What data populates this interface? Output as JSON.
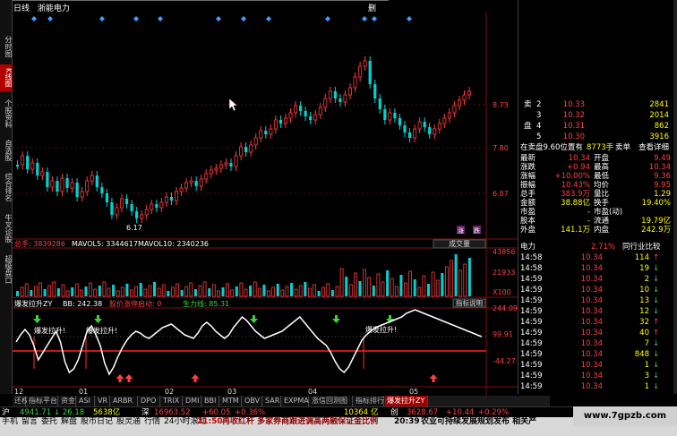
{
  "app": {
    "chart_mode": "日线",
    "stock_name": "浙能电力",
    "corner_label": "删"
  },
  "left_tabs": [
    "分时图",
    "K线图",
    "个股资料",
    "自选股",
    "综合排名",
    "牛叉诊股",
    "超级盘口"
  ],
  "price_axis": [
    "8.73",
    "7.80",
    "6.87"
  ],
  "kline": {
    "low_label": "6.17"
  },
  "volume": {
    "label": "总手: 3839286",
    "ma5": "MAVOL5: 3344617",
    "ma10": "MAVOL10: 2340236",
    "dropdown": "成交量",
    "axis": [
      "43856",
      "21933",
      "X100"
    ]
  },
  "indicator": {
    "name": "爆发拉升ZY",
    "bb": "BB: 242.38",
    "tag1": "股价涨停启动: 0",
    "tag2": "生力线: 85.31",
    "help": "指标说明",
    "axis": [
      "244.09",
      "99.91",
      "-44.27"
    ],
    "signal": "爆发拉升!"
  },
  "x_axis": [
    "12",
    "01",
    "02",
    "03",
    "04",
    "05"
  ],
  "icons": {
    "mark1": "涨",
    "mark2": "跌"
  },
  "right_panel": {
    "orderbook": [
      {
        "side": "卖",
        "lvl": "2",
        "price": "10.33",
        "vol": "2841"
      },
      {
        "side": "",
        "lvl": "3",
        "price": "10.32",
        "vol": "2014"
      },
      {
        "side": "盘",
        "lvl": "4",
        "price": "10.31",
        "vol": "862"
      },
      {
        "side": "",
        "lvl": "5",
        "price": "10.30",
        "vol": "3916"
      }
    ],
    "sell_header": {
      "a": "在卖盘9.60位置有",
      "b": "8773手",
      "c": "卖单",
      "d": "查看详细"
    },
    "quote": [
      {
        "l": "最新",
        "lv": "10.34",
        "r": "开盘",
        "rv": "9.49"
      },
      {
        "l": "涨跌",
        "lv": "+0.94",
        "r": "最高",
        "rv": "10.34"
      },
      {
        "l": "涨幅",
        "lv": "+10.00%",
        "r": "最低",
        "rv": "9.36"
      },
      {
        "l": "振幅",
        "lv": "10.43%",
        "r": "均价",
        "rv": "9.95"
      },
      {
        "l": "总手",
        "lv": "383.9万",
        "r": "量比",
        "rv": "1.29"
      },
      {
        "l": "金额",
        "lv": "38.88亿",
        "r": "换手",
        "rv": "19.40%"
      },
      {
        "l": "市盈",
        "lv": "-",
        "r": "市盈(动)",
        "rv": ""
      },
      {
        "l": "股本",
        "lv": "-",
        "r": "流通",
        "rv": "19.79亿"
      },
      {
        "l": "外盘",
        "lv": "141.1万",
        "r": "内盘",
        "rv": "242.9万"
      }
    ],
    "industry": {
      "name": "电力",
      "pct": "2.71%",
      "link": "同行业比较"
    },
    "ticks": [
      {
        "t": "14:58",
        "p": "10.34",
        "v": "114",
        "d": "up"
      },
      {
        "t": "14:58",
        "p": "10.34",
        "v": "19",
        "d": "down"
      },
      {
        "t": "14:59",
        "p": "10.34",
        "v": "2",
        "d": "down"
      },
      {
        "t": "14:59",
        "p": "10.34",
        "v": "10",
        "d": "down"
      },
      {
        "t": "14:59",
        "p": "10.34",
        "v": "13",
        "d": "down"
      },
      {
        "t": "14:59",
        "p": "10.34",
        "v": "12",
        "d": "down"
      },
      {
        "t": "14:59",
        "p": "10.34",
        "v": "32",
        "d": "up"
      },
      {
        "t": "14:59",
        "p": "10.34",
        "v": "40",
        "d": "up"
      },
      {
        "t": "14:59",
        "p": "10.34",
        "v": "7",
        "d": "down"
      },
      {
        "t": "14:59",
        "p": "10.34",
        "v": "848",
        "d": "down"
      },
      {
        "t": "14:59",
        "p": "10.34",
        "v": "1",
        "d": "down"
      },
      {
        "t": "14:59",
        "p": "10.34",
        "v": "3",
        "d": "down"
      },
      {
        "t": "14:59",
        "p": "10.34",
        "v": "1",
        "d": "down"
      }
    ]
  },
  "tabs": [
    "还权",
    "指标平台",
    "资金",
    "ASI",
    "VR",
    "ARBR",
    "DPO",
    "TRIX",
    "DMI",
    "BBI",
    "MTM",
    "OBV",
    "SAR",
    "EXPMA",
    "涨信回测图",
    "指标排行",
    "爆发拉升ZY"
  ],
  "status": {
    "sh_label": "沪",
    "sh_val": "4941.71",
    "sh_chg": "↓ 26.18",
    "sh_amt": "5638亿",
    "sz_label": "深",
    "sz_val": "16963.52",
    "sz_chg": "+60.05",
    "sz_pct": "+0.36%",
    "cy_val": "10364",
    "cy_unit": "亿",
    "cy_label": "创",
    "cy_idx": "3628.67",
    "cy_chg": "+10.44",
    "cy_pct": "+0.29%",
    "news_time": "21:50",
    "news": "再收红杆 多家券商跟进调高两融保证金比例",
    "news2_time": "20:39",
    "news2": "农业可持续发展规划发布 相关产"
  },
  "menu": [
    "手机",
    "留言",
    "委托",
    "解盘",
    "股市日记",
    "股灵通",
    "行情",
    "24小时滚动"
  ],
  "watermark": "www.7gpzb.com"
}
